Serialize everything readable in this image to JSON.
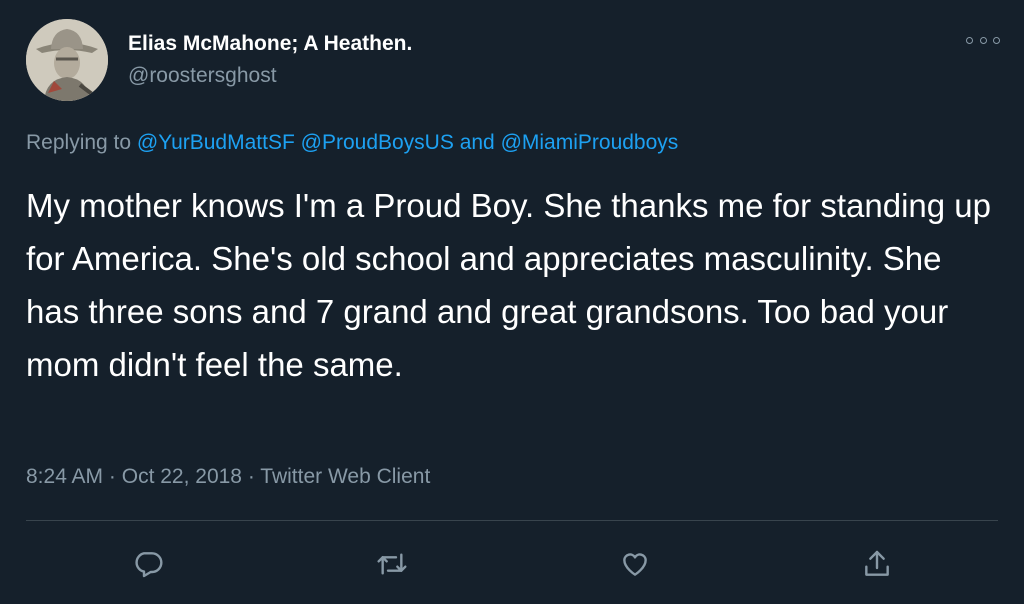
{
  "user": {
    "display_name": "Elias McMahone; A Heathen.",
    "handle": "@roostersghost",
    "avatar_icon": "cowboy-avatar"
  },
  "reply": {
    "prefix": "Replying to ",
    "mention_1": "@YurBudMattSF",
    "mention_2": "@ProudBoysUS",
    "and_text": " and ",
    "mention_3": "@MiamiProudboys"
  },
  "tweet": {
    "text": "My mother knows I'm a Proud Boy. She thanks me for standing up for America. She's old school and appreciates masculinity. She has three sons and 7 grand and great grandsons. Too bad your mom didn't feel the same."
  },
  "meta": {
    "time": "8:24 AM",
    "sep1": " · ",
    "date": "Oct 22, 2018",
    "sep2": " · ",
    "client": "Twitter Web Client"
  },
  "actions": [
    "reply-icon",
    "retweet-icon",
    "like-icon",
    "share-icon"
  ],
  "colors": {
    "background": "#15202b",
    "secondary_text": "#8899a6",
    "link": "#1da1f2",
    "divider": "#38444d"
  }
}
